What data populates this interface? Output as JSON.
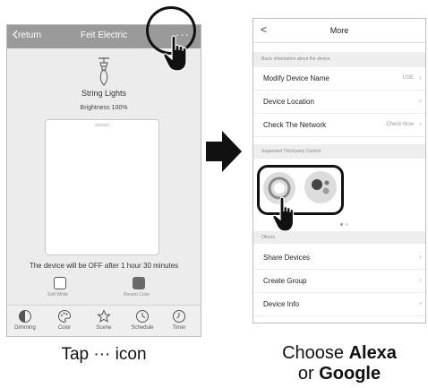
{
  "left_screen": {
    "back_label": "return",
    "title": "Feit Electric",
    "more_label": "···",
    "device_name": "String Lights",
    "brightness": "Brightness 100%",
    "off_message": "The device will be OFF after 1 hour 30 minutes",
    "soft_white_label": "Soft White",
    "recent_color_label": "Recent Color",
    "tabs": [
      {
        "label": "Dimming",
        "icon": "dimming-icon"
      },
      {
        "label": "Color",
        "icon": "palette-icon"
      },
      {
        "label": "Scene",
        "icon": "star-icon"
      },
      {
        "label": "Schedule",
        "icon": "clock-icon"
      },
      {
        "label": "Timer",
        "icon": "timer-icon"
      }
    ]
  },
  "right_screen": {
    "back_label": "<",
    "title": "More",
    "section_basic": "Basic information about the device",
    "rows_basic": [
      {
        "label": "Modify Device Name",
        "value": "USE"
      },
      {
        "label": "Device Location",
        "value": ""
      },
      {
        "label": "Check The Network",
        "value": "Check Now"
      }
    ],
    "section_third_party": "Supported Third-party Control",
    "third_party": [
      {
        "name": "alexa",
        "icon": "alexa-icon"
      },
      {
        "name": "google",
        "icon": "google-assistant-icon"
      }
    ],
    "section_others": "Others",
    "rows_others": [
      {
        "label": "Share Devices"
      },
      {
        "label": "Create Group"
      },
      {
        "label": "Device Info"
      }
    ]
  },
  "captions": {
    "left_pre": "Tap ",
    "left_dots": "···",
    "left_post": " icon",
    "right_line1_pre": "Choose ",
    "right_line1_bold": "Alexa",
    "right_line2_pre": "or ",
    "right_line2_bold": "Google"
  },
  "colors": {
    "left_topbar": "#9a9a9a",
    "left_background": "#ececec",
    "highlight_outline": "#111111",
    "arrow": "#111111"
  }
}
